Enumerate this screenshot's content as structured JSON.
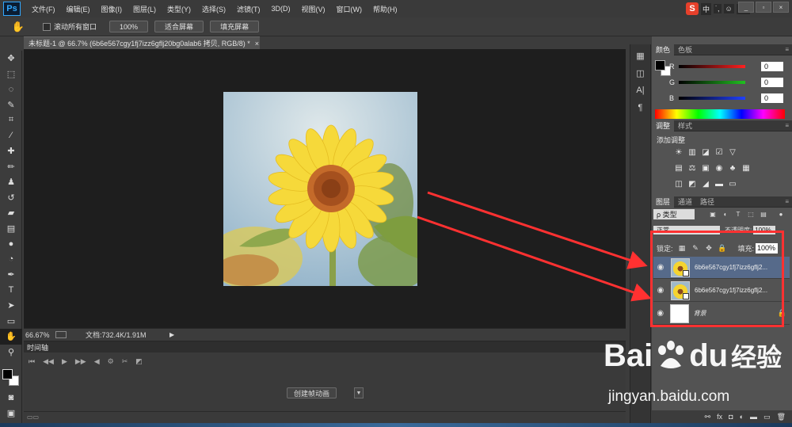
{
  "app": {
    "logo": "Ps",
    "menu": [
      "文件(F)",
      "编辑(E)",
      "图像(I)",
      "图层(L)",
      "类型(Y)",
      "选择(S)",
      "滤镜(T)",
      "3D(D)",
      "视图(V)",
      "窗口(W)",
      "帮助(H)"
    ],
    "ime": {
      "s": "S",
      "items": [
        "中",
        "˙,",
        "☺",
        "⌨"
      ]
    }
  },
  "options": {
    "scroll_all_label": "滚动所有窗口",
    "zoom_100": "100%",
    "fit_screen": "适合屏幕",
    "fill_screen": "填充屏幕"
  },
  "document": {
    "tab_title": "未标题-1 @ 66.7% (6b6e567cgy1fj7izz6gflj20bg0alab6 拷贝, RGB/8) *",
    "close": "×"
  },
  "status": {
    "zoom": "66.67%",
    "doc_size": "文档:732.4K/1.91M",
    "arrow": "▶"
  },
  "timeline": {
    "tab": "时间轴",
    "create_button": "创建帧动画",
    "dropdown": "▼"
  },
  "color_panel": {
    "tabs": [
      "颜色",
      "色板"
    ],
    "channels": [
      {
        "label": "R",
        "value": "0",
        "color": "#ff2020"
      },
      {
        "label": "G",
        "value": "0",
        "color": "#20c020"
      },
      {
        "label": "B",
        "value": "0",
        "color": "#2040ff"
      }
    ]
  },
  "adjustments_panel": {
    "tabs": [
      "调整",
      "样式"
    ],
    "title": "添加调整",
    "row1": [
      "☀",
      "▥",
      "◪",
      "☑",
      "▽"
    ],
    "row2": [
      "▤",
      "⚖",
      "▣",
      "◉",
      "♣",
      "▦"
    ],
    "row3": [
      "◫",
      "◩",
      "◢",
      "▬",
      "▭"
    ]
  },
  "layers_panel": {
    "tabs": [
      "图层",
      "通道",
      "路径"
    ],
    "filter_label": "ρ 类型",
    "mode": "正常",
    "opacity_label": "不透明度:",
    "opacity": "100%",
    "lock_label": "锁定:",
    "fill_label": "填充:",
    "fill": "100%",
    "layers": [
      {
        "name": "6b6e567cgy1fj7izz6gflj2...",
        "selected": true,
        "thumb": "flower"
      },
      {
        "name": "6b6e567cgy1fj7izz6gflj2...",
        "selected": false,
        "thumb": "flower"
      },
      {
        "name": "背景",
        "selected": false,
        "thumb": "white",
        "locked": true
      }
    ],
    "footer": [
      "⚯",
      "fx",
      "◘",
      "◐",
      "▬",
      "▭",
      "🗑"
    ]
  },
  "watermark": {
    "bai": "Bai",
    "du": "du",
    "jingyan": "经验",
    "url": "jingyan.baidu.com"
  },
  "accent": {
    "annotation_red": "#ff3131",
    "selected_layer": "#566a8a"
  }
}
